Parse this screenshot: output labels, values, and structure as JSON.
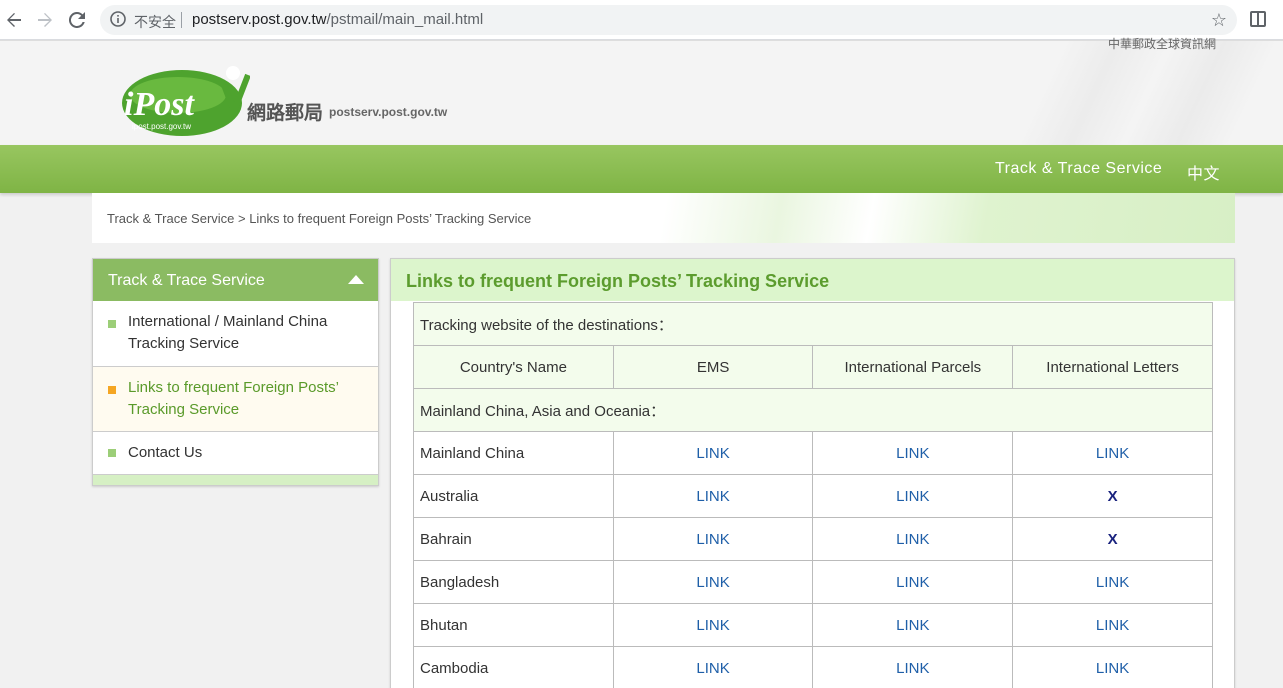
{
  "browser": {
    "insecure_label": "不安全",
    "url_host": "postserv.post.gov.tw",
    "url_path": "/pstmail/main_mail.html"
  },
  "site": {
    "top_cut_text": "中華郵政全球資訊網",
    "logo_text": "iPost",
    "logo_subtext": "ipost.post.gov.tw",
    "logo_cn": "網路郵局",
    "logo_domain": "postserv.post.gov.tw",
    "nav": {
      "track": "Track & Trace Service",
      "lang": "中文"
    },
    "breadcrumb": "Track & Trace Service > Links to frequent Foreign Posts’ Tracking Service"
  },
  "sidebar": {
    "title": "Track & Trace Service",
    "items": [
      {
        "label": "International / Mainland China Tracking Service"
      },
      {
        "label": "Links to frequent Foreign Posts’ Tracking Service"
      },
      {
        "label": "Contact Us"
      }
    ]
  },
  "main": {
    "title": "Links to frequent Foreign Posts’ Tracking Service",
    "note": "Tracking website of the destinations：",
    "headers": [
      "Country's Name",
      "EMS",
      "International Parcels",
      "International Letters"
    ],
    "region": "Mainland China, Asia and Oceania：",
    "rows": [
      {
        "country": "Mainland China",
        "ems": "LINK",
        "parcels": "LINK",
        "letters": "LINK"
      },
      {
        "country": "Australia",
        "ems": "LINK",
        "parcels": "LINK",
        "letters": "X"
      },
      {
        "country": "Bahrain",
        "ems": "LINK",
        "parcels": "LINK",
        "letters": "X"
      },
      {
        "country": "Bangladesh",
        "ems": "LINK",
        "parcels": "LINK",
        "letters": "LINK"
      },
      {
        "country": "Bhutan",
        "ems": "LINK",
        "parcels": "LINK",
        "letters": "LINK"
      },
      {
        "country": "Cambodia",
        "ems": "LINK",
        "parcels": "LINK",
        "letters": "LINK"
      }
    ]
  },
  "colors": {
    "green_bar": "#8bbb62",
    "title_green": "#5c9c2e",
    "link_blue": "#1f5fa8"
  }
}
